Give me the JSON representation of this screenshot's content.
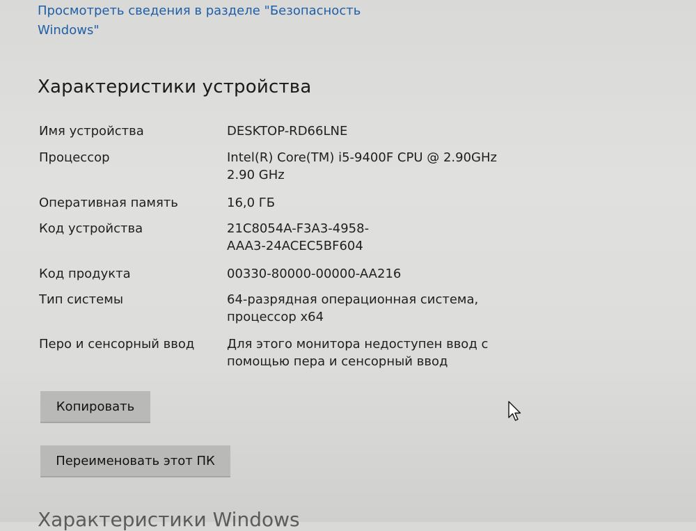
{
  "security_link": {
    "text": "Просмотреть сведения в разделе \"Безопасность Windows\""
  },
  "device_specs": {
    "title": "Характеристики устройства",
    "rows": [
      {
        "label": "Имя устройства",
        "value": "DESKTOP-RD66LNE"
      },
      {
        "label": "Процессор",
        "value": "Intel(R) Core(TM) i5-9400F CPU @ 2.90GHz\n2.90 GHz"
      },
      {
        "label": "Оперативная память",
        "value": "16,0 ГБ"
      },
      {
        "label": "Код устройства",
        "value": "21C8054A-F3A3-4958-\nAAA3-24ACEC5BF604"
      },
      {
        "label": "Код продукта",
        "value": "00330-80000-00000-AA216"
      },
      {
        "label": "Тип системы",
        "value": "64-разрядная операционная система,\nпроцессор x64"
      },
      {
        "label": "Перо и сенсорный ввод",
        "value": "Для этого монитора недоступен ввод с\nпомощью пера и сенсорный ввод"
      }
    ],
    "copy_button": "Копировать",
    "rename_button": "Переименовать этот ПК"
  },
  "next_section": {
    "title": "Характеристики Windows"
  },
  "icons": {
    "cursor": "mouse-pointer-icon"
  }
}
